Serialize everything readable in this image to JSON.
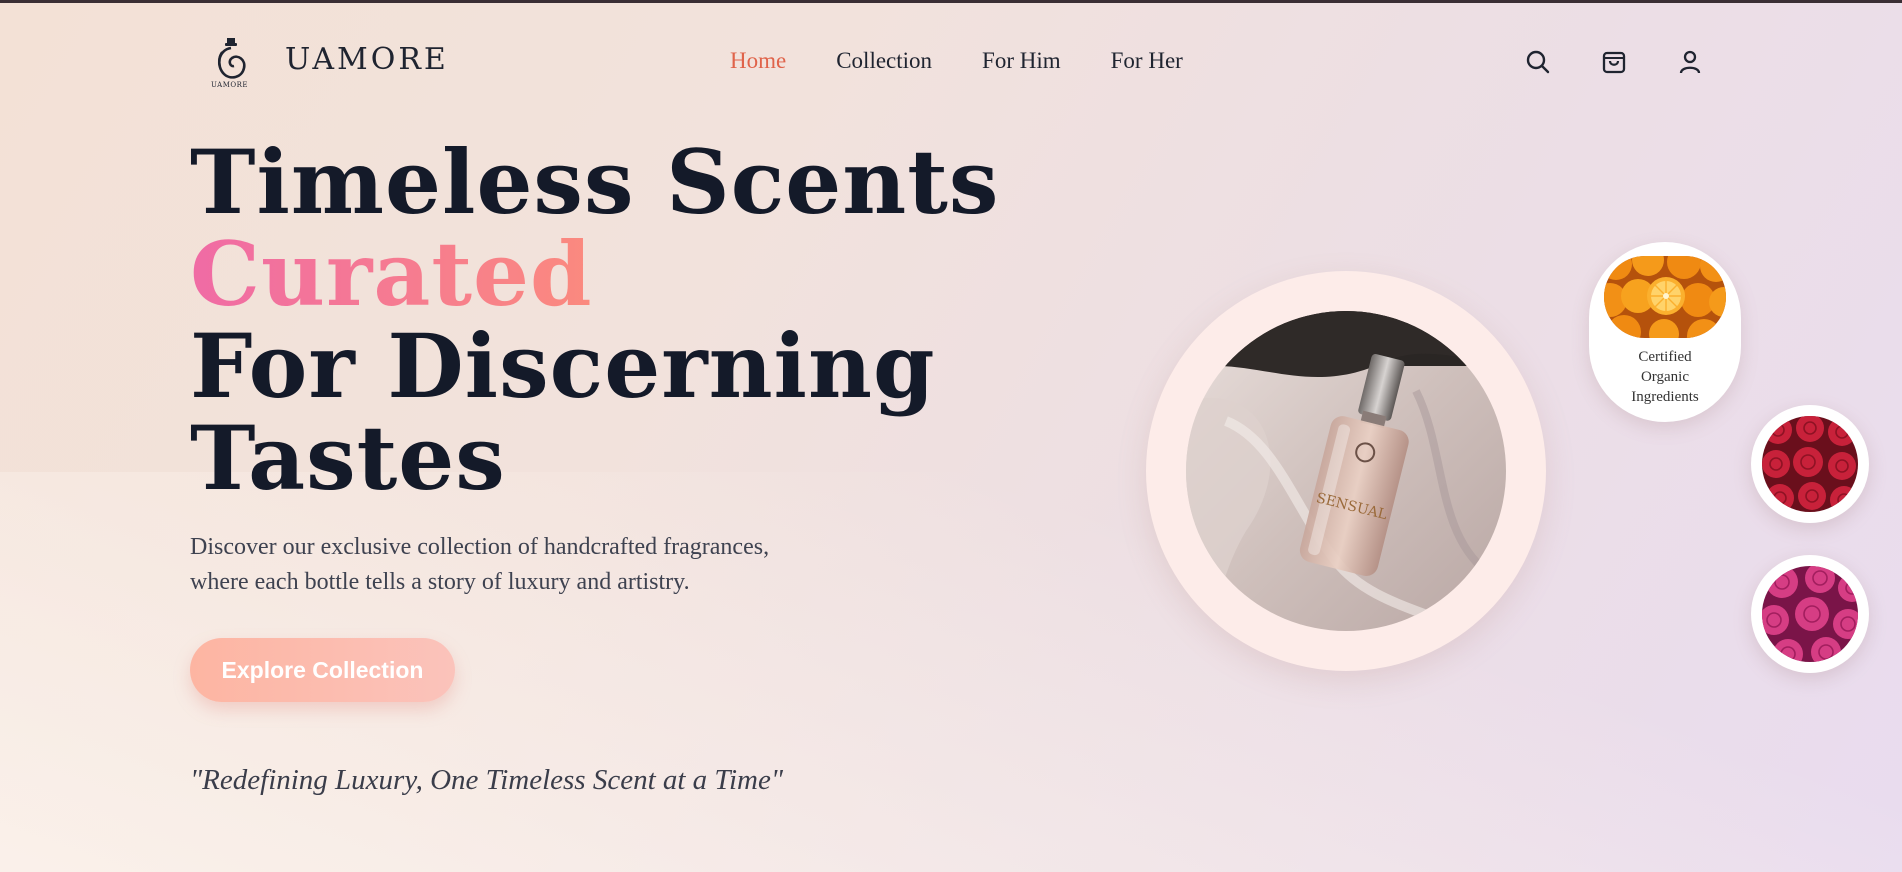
{
  "header": {
    "logo_text": "UAMORE",
    "brand": "UAMORE",
    "nav": [
      {
        "label": "Home",
        "active": true
      },
      {
        "label": "Collection",
        "active": false
      },
      {
        "label": "For Him",
        "active": false
      },
      {
        "label": "For Her",
        "active": false
      }
    ],
    "icons": [
      "search-icon",
      "shopping-bag-icon",
      "user-icon"
    ]
  },
  "hero": {
    "title_line1": "Timeless Scents",
    "title_line2": "Curated",
    "title_line3": "For Discerning",
    "title_line4": "Tastes",
    "description": "Discover our exclusive collection of handcrafted fragrances, where each bottle tells a story of luxury and artistry.",
    "cta_label": "Explore Collection",
    "quote": "\"Redefining Luxury, One Timeless Scent at a Time\""
  },
  "product": {
    "bottle_label": "SENSUAL"
  },
  "badges": {
    "organic_text": "Certified\nOrganic\nIngredients"
  },
  "colors": {
    "accent": "#e0634a",
    "heading": "#141a29",
    "cta_start": "#fdb5a2",
    "cta_end": "#fbc3bb",
    "gradient_pink": "#f06ba5",
    "gradient_coral": "#fb8a7e"
  }
}
